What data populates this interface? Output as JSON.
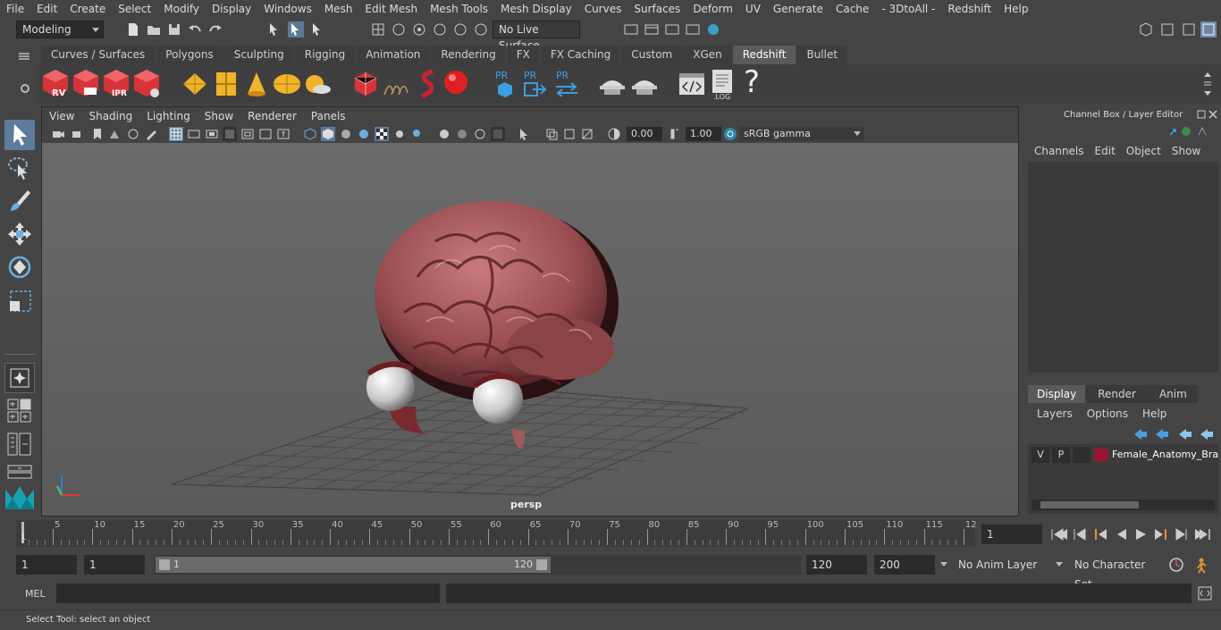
{
  "menubar": {
    "items": [
      "File",
      "Edit",
      "Create",
      "Select",
      "Modify",
      "Display",
      "Windows",
      "Mesh",
      "Edit Mesh",
      "Mesh Tools",
      "Mesh Display",
      "Curves",
      "Surfaces",
      "Deform",
      "UV",
      "Generate",
      "Cache",
      "- 3DtoAll -",
      "Redshift",
      "Help"
    ]
  },
  "statusline": {
    "mode": "Modeling",
    "live_surface": "No Live Surface"
  },
  "shelf": {
    "tabs": [
      "Curves / Surfaces",
      "Polygons",
      "Sculpting",
      "Rigging",
      "Animation",
      "Rendering",
      "FX",
      "FX Caching",
      "Custom",
      "XGen",
      "Redshift",
      "Bullet"
    ],
    "active_tab": "Redshift",
    "icon_labels": {
      "rv": "RV",
      "ipr": "IPR",
      "pr": "PR",
      "log": ".LOG",
      "help": "?"
    }
  },
  "viewport": {
    "menu": [
      "View",
      "Shading",
      "Lighting",
      "Show",
      "Renderer",
      "Panels"
    ],
    "exposure": "0.00",
    "gamma": "1.00",
    "color_space": "sRGB gamma",
    "camera_label": "persp"
  },
  "channelbox": {
    "title": "Channel Box / Layer Editor",
    "menu": [
      "Channels",
      "Edit",
      "Object",
      "Show"
    ]
  },
  "layereditor": {
    "tabs": [
      "Display",
      "Render",
      "Anim"
    ],
    "active_tab": "Display",
    "menu": [
      "Layers",
      "Options",
      "Help"
    ],
    "layer": {
      "v": "V",
      "p": "P",
      "name": "Female_Anatomy_Brain",
      "color": "#9b1530"
    }
  },
  "timeline": {
    "ticks": [
      "5",
      "10",
      "15",
      "20",
      "25",
      "30",
      "35",
      "40",
      "45",
      "50",
      "55",
      "60",
      "65",
      "70",
      "75",
      "80",
      "85",
      "90",
      "95",
      "100",
      "105",
      "110",
      "115",
      "12"
    ],
    "start_marker": "1",
    "current_frame": "1"
  },
  "range": {
    "start": "1",
    "playback_start": "1",
    "slider_start": "1",
    "slider_end": "120",
    "playback_end": "120",
    "end": "200",
    "anim_layer": "No Anim Layer",
    "character_set": "No Character Set"
  },
  "cmdline": {
    "label": "MEL"
  },
  "helpline": {
    "text": "Select Tool: select an object"
  }
}
